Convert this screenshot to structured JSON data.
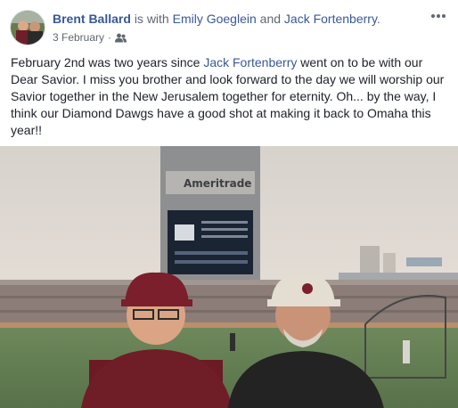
{
  "post": {
    "author": "Brent Ballard",
    "with_text": "is with",
    "tagged_1": "Emily Goeglein",
    "and_text": "and",
    "tagged_2": "Jack Fortenberry",
    "period": ".",
    "date": "3 February",
    "dot": "·",
    "audience_icon": "friends-icon",
    "more_icon": "more-options-icon"
  },
  "body": {
    "part1": "February 2nd was two years since ",
    "mention": "Jack Fortenberry",
    "part2": " went on to be with our Dear Savior. I miss you brother and look forward to the day we will worship our Savior together in the New Jerusalem together for eternity. Oh... by the way, I think our Diamond Dawgs have a good shot at making it back to Omaha this year!!"
  },
  "photo": {
    "scoreboard_text": "Ameritrade"
  },
  "colors": {
    "link": "#385898",
    "text": "#1d2129",
    "meta": "#616770"
  }
}
